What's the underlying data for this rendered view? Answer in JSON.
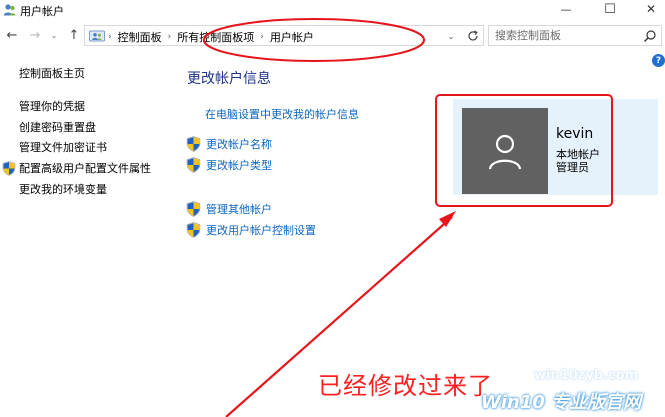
{
  "window": {
    "title": "用户帐户",
    "minimize_glyph": "—",
    "maximize_glyph": "☐",
    "close_glyph": "✕"
  },
  "navigation": {
    "back_glyph": "←",
    "forward_glyph": "→",
    "recent_glyph": "⌄",
    "up_glyph": "↑",
    "breadcrumb": [
      "控制面板",
      "所有控制面板项",
      "用户帐户"
    ],
    "breadcrumb_separator": "›",
    "dropdown_glyph": "⌄",
    "search_placeholder": "搜索控制面板"
  },
  "help_glyph": "?",
  "sidebar": {
    "home": "控制面板主页",
    "items": [
      {
        "label": "管理你的凭据",
        "shield": false
      },
      {
        "label": "创建密码重置盘",
        "shield": false
      },
      {
        "label": "管理文件加密证书",
        "shield": false
      },
      {
        "label": "配置高级用户配置文件属性",
        "shield": true
      },
      {
        "label": "更改我的环境变量",
        "shield": false
      }
    ]
  },
  "main": {
    "title": "更改帐户信息",
    "pc_settings_link": "在电脑设置中更改我的帐户信息",
    "tasks_group1": [
      "更改帐户名称",
      "更改帐户类型"
    ],
    "tasks_group2": [
      "管理其他帐户",
      "更改用户帐户控制设置"
    ]
  },
  "account": {
    "name": "kevin",
    "type": "本地帐户",
    "role": "管理员"
  },
  "annotation": {
    "caption": "已经修改过来了",
    "highlight_color": "#e8141b"
  },
  "watermark": {
    "line1": "win10zyb.com",
    "line2": "Win10 专业版官网"
  },
  "colors": {
    "link": "#0a66c2",
    "heading": "#1e3287",
    "card_bg": "#e5f1fb",
    "avatar_bg": "#616161"
  }
}
